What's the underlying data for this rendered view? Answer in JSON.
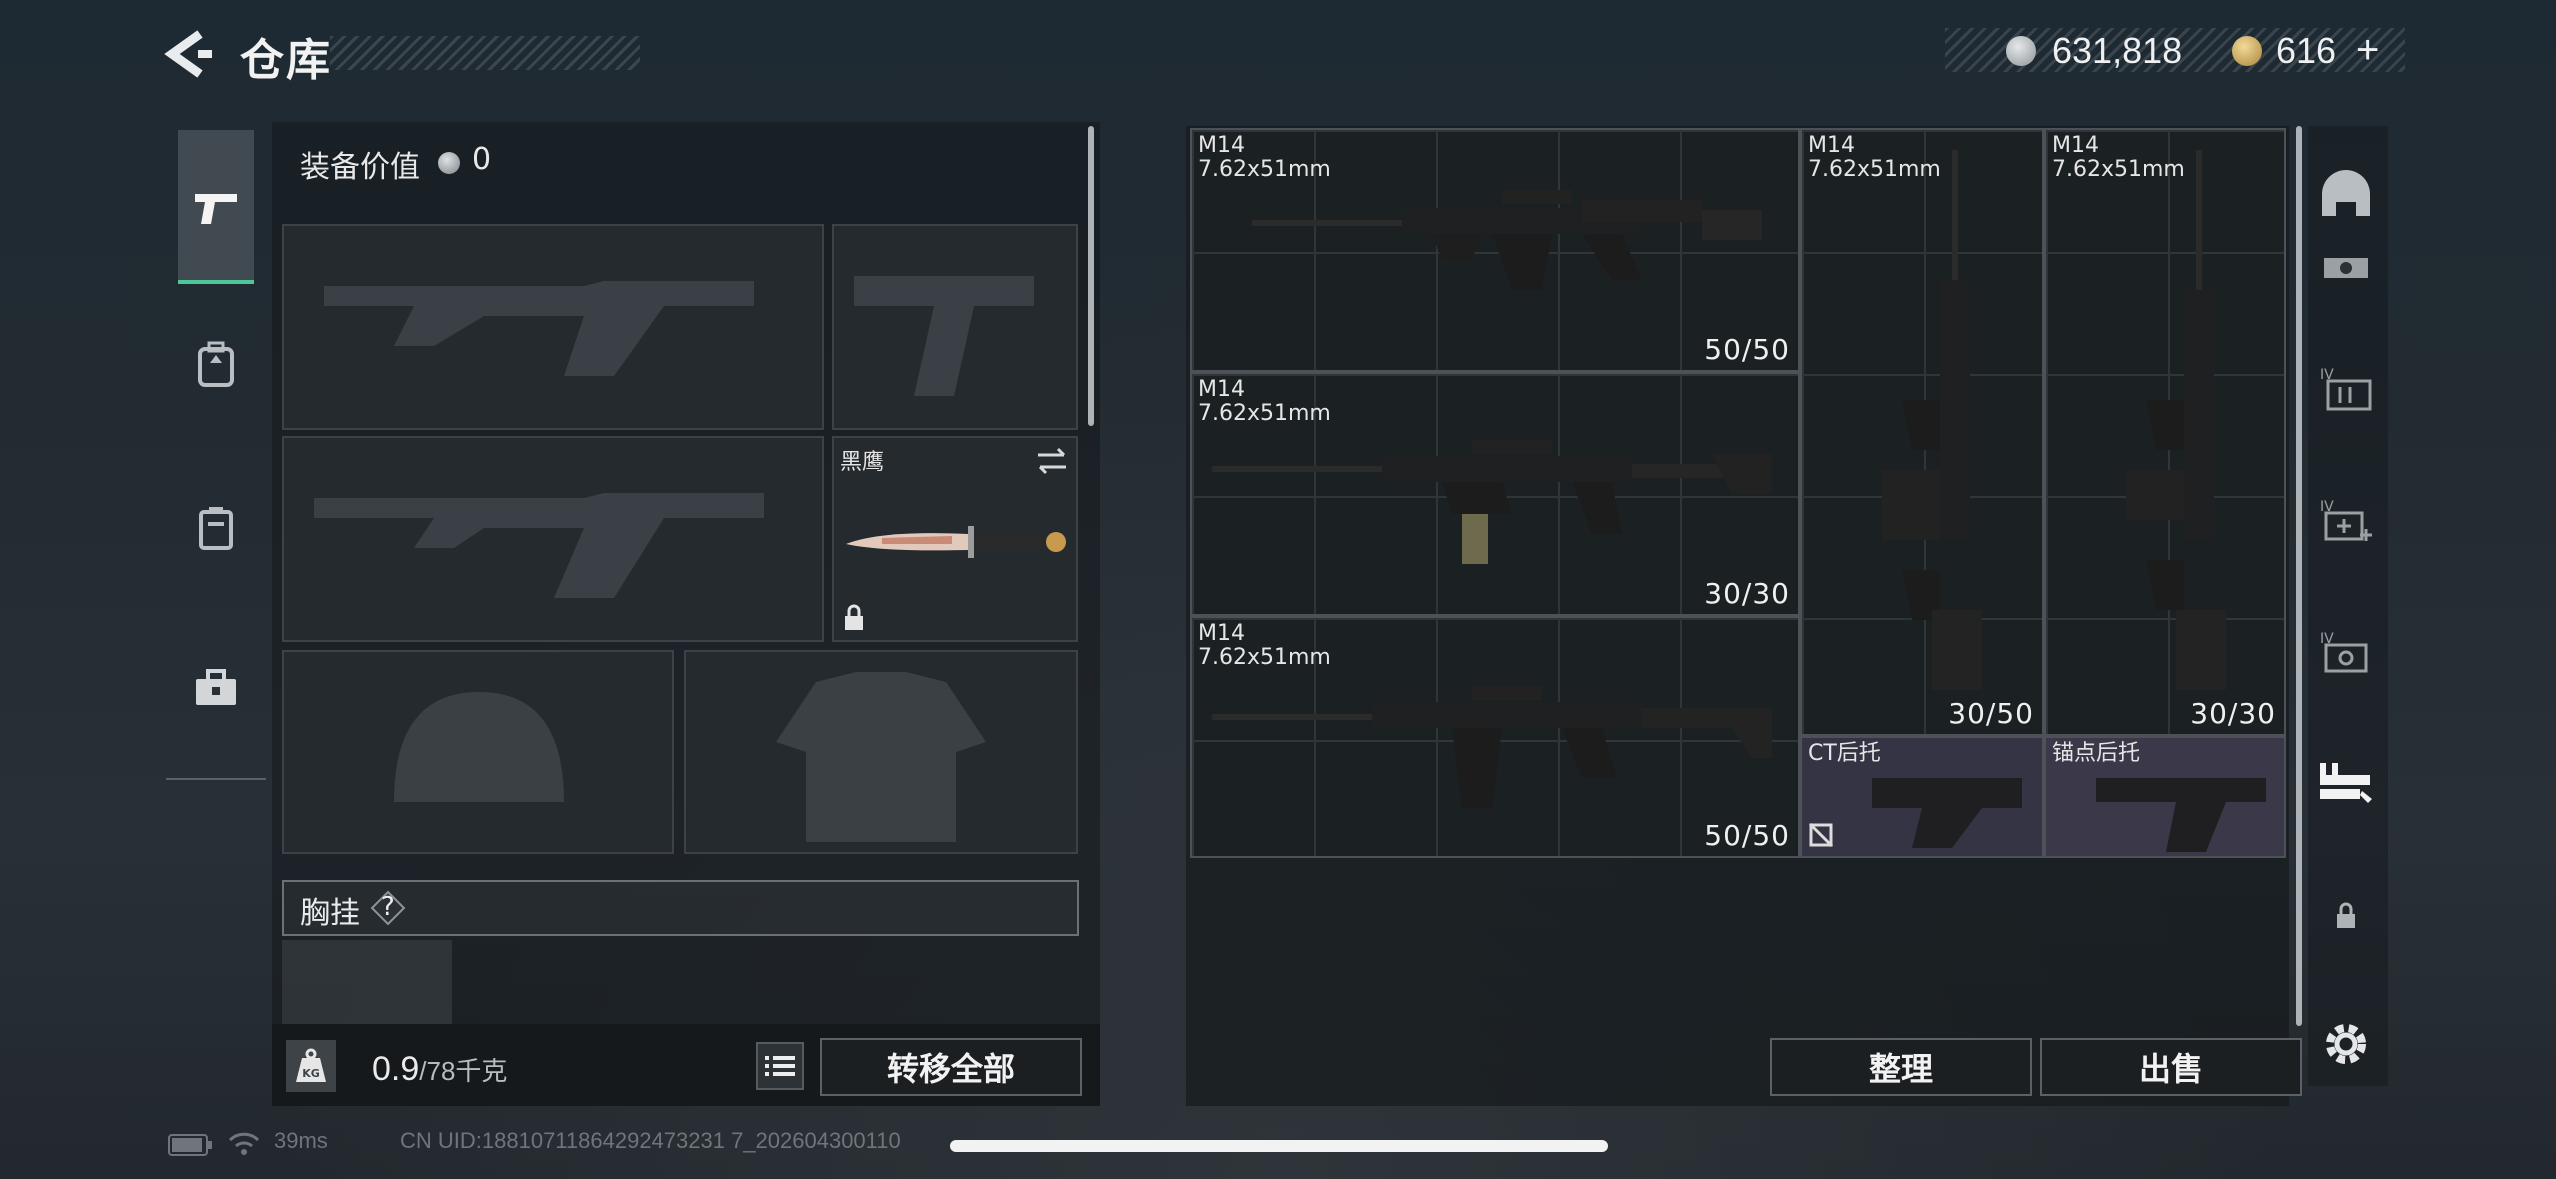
{
  "header": {
    "title": "仓库",
    "currency_primary": "631,818",
    "currency_secondary": "616",
    "add_symbol": "+"
  },
  "nav": {
    "items": [
      "pistol-icon",
      "backpack-icon",
      "locker-icon",
      "briefcase-icon"
    ],
    "active_index": 0
  },
  "loadout": {
    "equipment_value_label": "装备价值",
    "equipment_value": "0",
    "melee_name": "黑鹰",
    "chest_label": "胸挂",
    "chest_help": "?",
    "weight_current": "0.9",
    "weight_max": "/78千克",
    "transfer_all_label": "转移全部"
  },
  "storage": {
    "items": [
      {
        "name": "M14",
        "ammo_type": "7.62x51mm",
        "count": "50/50"
      },
      {
        "name": "M14",
        "ammo_type": "7.62x51mm",
        "count": "30/30"
      },
      {
        "name": "M14",
        "ammo_type": "7.62x51mm",
        "count": "50/50"
      },
      {
        "name": "M14",
        "ammo_type": "7.62x51mm",
        "count": "30/50"
      },
      {
        "name": "M14",
        "ammo_type": "7.62x51mm",
        "count": "30/30"
      },
      {
        "name": "CT后托",
        "ammo_type": "",
        "count": ""
      },
      {
        "name": "锚点后托",
        "ammo_type": "",
        "count": ""
      }
    ],
    "sort_label": "整理",
    "sell_label": "出售"
  },
  "colors": {
    "accent_green": "#4fc59b",
    "panel": "#1b1f22",
    "highlight_cell": "#3a3848"
  },
  "status": {
    "ping": "39ms",
    "uid": "CN UID:18810711864292473231 7_202604300110"
  }
}
